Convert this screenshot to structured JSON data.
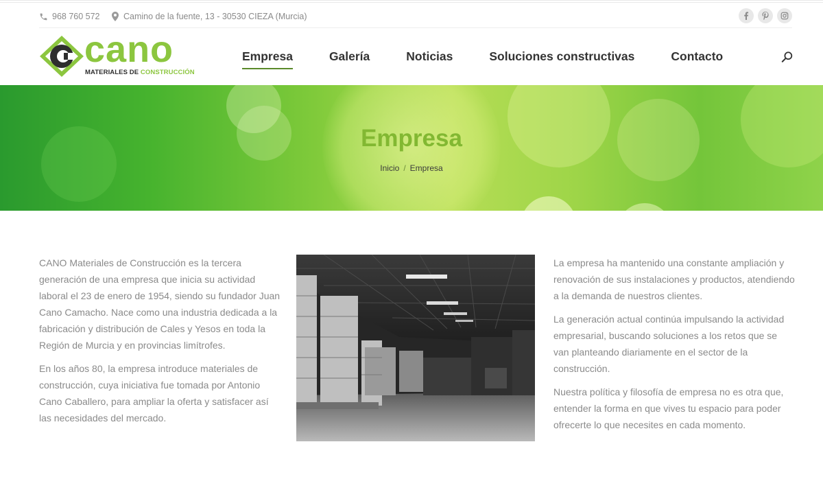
{
  "topbar": {
    "phone": "968 760 572",
    "address": "Camino de la fuente, 13 - 30530 CIEZA (Murcia)",
    "socials": [
      "facebook-icon",
      "pinterest-icon",
      "instagram-icon"
    ]
  },
  "logo": {
    "word": "cano",
    "sub_dark": "MATERIALES DE ",
    "sub_green": "CONSTRUCCIÓN"
  },
  "nav": {
    "items": [
      "Empresa",
      "Galería",
      "Noticias",
      "Soluciones constructivas",
      "Contacto"
    ],
    "active": "Empresa"
  },
  "hero": {
    "title": "Empresa",
    "breadcrumb_home": "Inicio",
    "breadcrumb_sep": "/",
    "breadcrumb_current": "Empresa"
  },
  "content": {
    "left": [
      "CANO Materiales de Construcción es la tercera generación de una empresa que inicia su actividad laboral el 23 de enero de 1954, siendo su fundador Juan Cano Camacho. Nace como una industria dedicada a la fabricación y distribución de Cales y Yesos en toda la Región de Murcia y en provincias limítrofes.",
      "En los años 80, la empresa introduce materiales de construcción, cuya iniciativa fue tomada por Antonio Cano Caballero, para ampliar la oferta y satisfacer así las necesidades del mercado."
    ],
    "right": [
      "La empresa ha mantenido una constante ampliación y renovación de sus instalaciones y productos, atendiendo a la demanda de nuestros clientes.",
      "La generación actual continúa impulsando la actividad empresarial, buscando soluciones a los retos que se van planteando diariamente en el sector de la construcción.",
      "Nuestra política y filosofía de empresa no es otra que, entender la forma en que vives tu espacio para poder ofrecerte lo que necesites en cada momento."
    ]
  },
  "colors": {
    "brand_green": "#8cc63f",
    "title_green": "#82b832",
    "nav_text": "#333333",
    "body_text": "#8a8a8a"
  }
}
